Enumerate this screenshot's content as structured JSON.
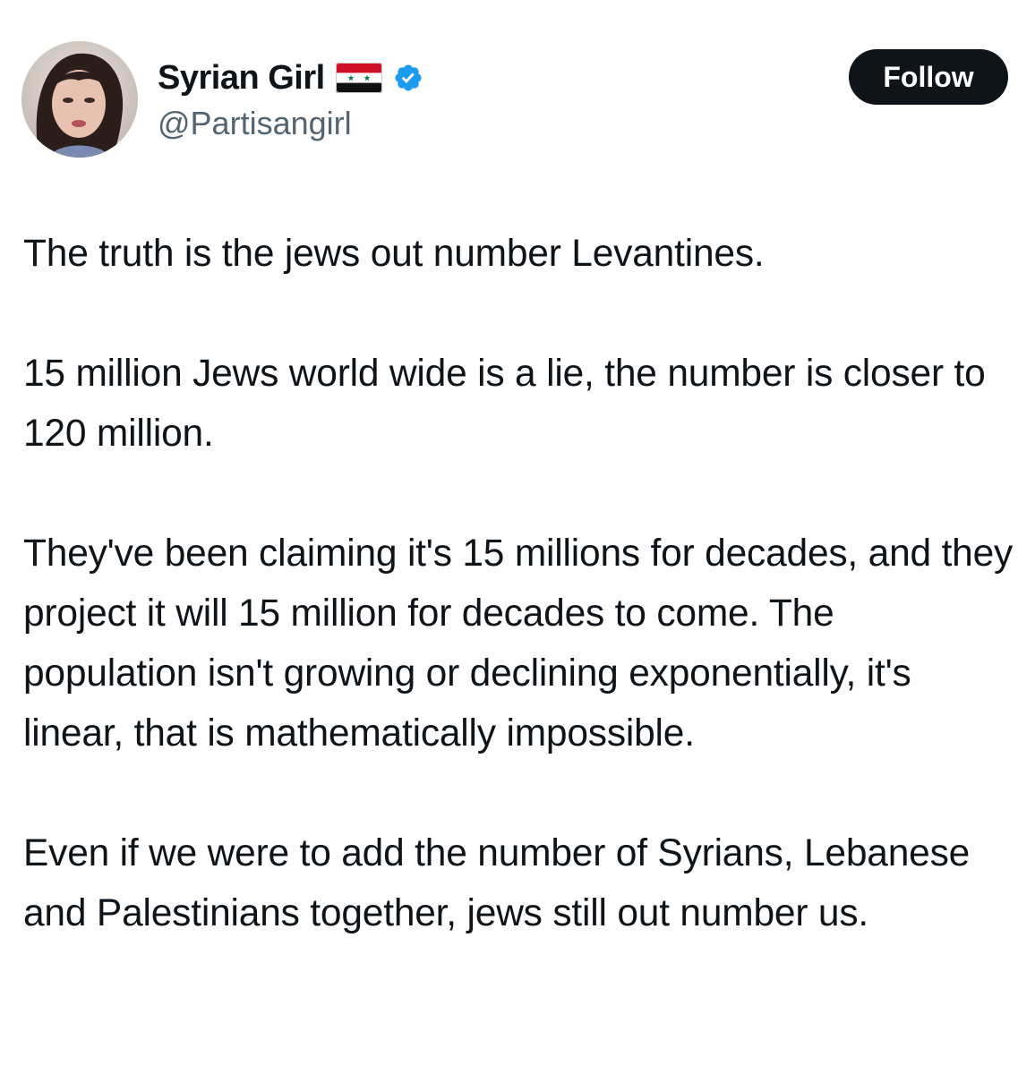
{
  "author": {
    "display_name": "Syrian Girl",
    "flag_icon": "syria-flag-icon",
    "verified_icon": "verified-badge-icon",
    "verified_color": "#1d9bf0",
    "handle": "@Partisangirl"
  },
  "actions": {
    "follow_label": "Follow"
  },
  "tweet": {
    "paragraphs": [
      "The truth is the jews out number Levantines.",
      "15 million Jews world wide is a lie, the number is closer to 120 million.",
      "They've been claiming it's 15 millions for decades, and they project it will 15 million for decades to come. The population isn't growing or declining exponentially, it's linear, that is mathematically impossible.",
      "Even if we were to add the number of  Syrians, Lebanese and Palestinians together, jews still out number us."
    ]
  },
  "colors": {
    "text": "#0f1419",
    "secondary_text": "#536471",
    "button_bg": "#0f1419",
    "button_text": "#ffffff"
  }
}
